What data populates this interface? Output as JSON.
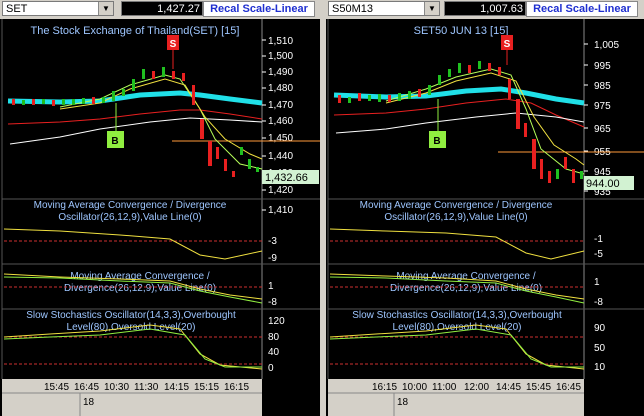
{
  "left": {
    "symbol": "SET",
    "last_price": "1,427.27",
    "recal_label": "Recal Scale-Linear",
    "title": "The Stock Exchange of Thailand(SET) [15]",
    "price_ticks": [
      "1,510",
      "1,500",
      "1,490",
      "1,480",
      "1,470",
      "1,460",
      "1,450",
      "1,440",
      "1,430",
      "1,420",
      "1,410"
    ],
    "price_tag": "1,432.66",
    "sell_marker": "S",
    "buy_marker": "B",
    "macd_label": "Moving Average Convergence / Divergence Oscillator(26,12,9),Value Line(0)",
    "macd_ticks": [
      "-3",
      "-9"
    ],
    "macd2_label": "Moving Average Convergence / Divergence(26,12,9),Value Line(0)",
    "macd2_ticks": [
      "1",
      "-8"
    ],
    "stoch_label": "Slow Stochastics Oscillator(14,3,3),Overbought Level(80),Oversold Level(20)",
    "stoch_ticks": [
      "120",
      "80",
      "40",
      "0"
    ],
    "time_ticks": [
      "15:45",
      "16:45",
      "10:30",
      "11:30",
      "14:15",
      "15:15",
      "16:15"
    ],
    "date_label": "18"
  },
  "right": {
    "symbol": "S50M13",
    "last_price": "1,007.63",
    "recal_label": "Recal Scale-Linear",
    "title": "SET50 JUN 13 [15]",
    "price_ticks": [
      "1,005",
      "995",
      "985",
      "975",
      "965",
      "955",
      "945",
      "935"
    ],
    "price_tag": "944.00",
    "sell_marker": "S",
    "buy_marker": "B",
    "macd_label": "Moving Average Convergence / Divergence Oscillator(26,12,9),Value Line(0)",
    "macd_ticks": [
      "-1",
      "-5"
    ],
    "macd2_label": "Moving Average Convergence / Divergence(26,12,9),Value Line(0)",
    "macd2_ticks": [
      "1",
      "-8"
    ],
    "stoch_label": "Slow Stochastics Oscillator(14,3,3),Overbought Level(80),Oversold Level(20)",
    "stoch_ticks": [
      "90",
      "50",
      "10"
    ],
    "time_ticks": [
      "16:15",
      "10:00",
      "11:00",
      "12:00",
      "14:45",
      "15:45",
      "16:45"
    ],
    "date_label": "18"
  },
  "colors": {
    "price_tag_bg": "#d2f2d2",
    "ma_cyan": "#20e0e8",
    "signal_red": "#e82020",
    "signal_green": "#90ee40"
  }
}
